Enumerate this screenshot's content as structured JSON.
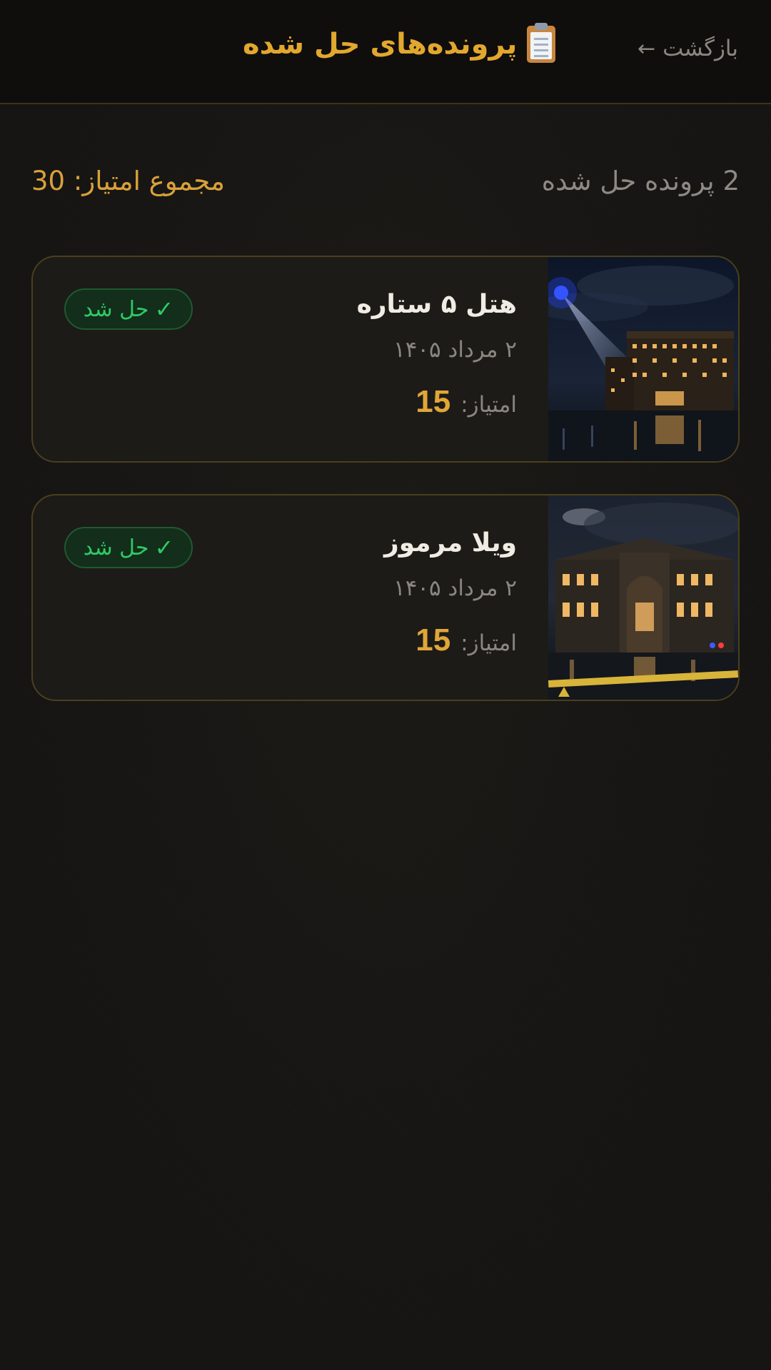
{
  "header": {
    "title": "پرونده‌های حل شده",
    "title_icon": "clipboard-icon",
    "back_label": "بازگشت",
    "back_arrow": "←"
  },
  "summary": {
    "solved_count": "2 پرونده حل شده",
    "total_score": "مجموع امتیاز: 30"
  },
  "cases": [
    {
      "name": "هتل ۵ ستاره",
      "date": "۲ مرداد ۱۴۰۵",
      "score_label": "امتیاز:",
      "score": "15",
      "status": "حل شد",
      "status_icon": "✓"
    },
    {
      "name": "ویلا مرموز",
      "date": "۲ مرداد ۱۴۰۵",
      "score_label": "امتیاز:",
      "score": "15",
      "status": "حل شد",
      "status_icon": "✓"
    }
  ],
  "colors": {
    "accent": "#e0a637",
    "success": "#2fca64",
    "background": "#151412"
  }
}
